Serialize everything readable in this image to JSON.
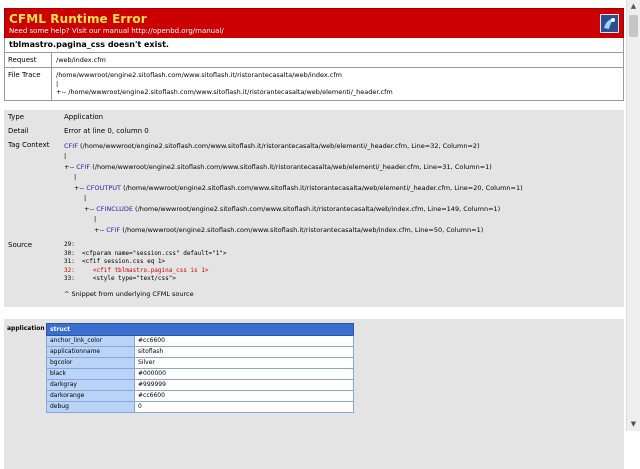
{
  "header": {
    "title": "CFML Runtime Error",
    "help_text": "Need some help? Visit our manual http://openbd.org/manual/",
    "logo_icon": "openbd-logo-icon"
  },
  "error": {
    "message": "tblmastro.pagina_css doesn't exist.",
    "request_label": "Request",
    "request_value": "/web/index.cfm",
    "filetrace_label": "File Trace",
    "filetrace_lines": [
      "/home/wwwroot/engine2.sitoflash.com/www.sitoflash.it/ristorantecasalta/web/index.cfm",
      "|",
      "+-- /home/wwwroot/engine2.sitoflash.com/www.sitoflash.it/ristorantecasalta/web/elementi/_header.cfm"
    ]
  },
  "details": {
    "type_label": "Type",
    "type_value": "Application",
    "detail_label": "Detail",
    "detail_value": "Error at line 0, column 0",
    "tag_context_label": "Tag Context",
    "tag_context": [
      {
        "prefix": "",
        "tag": "CFIF",
        "rest": " (/home/wwwroot/engine2.sitoflash.com/www.sitoflash.it/ristorantecasalta/web/elementi/_header.cfm, Line=32, Column=2)"
      },
      {
        "prefix": "|",
        "tag": "",
        "rest": ""
      },
      {
        "prefix": "+-- ",
        "tag": "CFIF",
        "rest": " (/home/wwwroot/engine2.sitoflash.com/www.sitoflash.it/ristorantecasalta/web/elementi/_header.cfm, Line=31, Column=1)"
      },
      {
        "prefix": "|",
        "tag": "",
        "rest": ""
      },
      {
        "prefix": "+-- ",
        "tag": "CFOUTPUT",
        "rest": " (/home/wwwroot/engine2.sitoflash.com/www.sitoflash.it/ristorantecasalta/web/elementi/_header.cfm, Line=20, Column=1)"
      },
      {
        "prefix": "|",
        "tag": "",
        "rest": ""
      },
      {
        "prefix": "+-- ",
        "tag": "CFINCLUDE",
        "rest": " (/home/wwwroot/engine2.sitoflash.com/www.sitoflash.it/ristorantecasalta/web/index.cfm, Line=149, Column=1)"
      },
      {
        "prefix": "|",
        "tag": "",
        "rest": ""
      },
      {
        "prefix": "+-- ",
        "tag": "CFIF",
        "rest": " (/home/wwwroot/engine2.sitoflash.com/www.sitoflash.it/ristorantecasalta/web/index.cfm, Line=50, Column=1)"
      }
    ],
    "source_label": "Source",
    "source_lines": [
      {
        "text": "29:",
        "highlight": false
      },
      {
        "text": "30:  <cfparam name=\"session.css\" default=\"1\">",
        "highlight": false
      },
      {
        "text": "31:  <cfif session.css eq 1>",
        "highlight": false
      },
      {
        "text": "32:     <cfif tblmastro.pagina_css is 1>",
        "highlight": true
      },
      {
        "text": "33:     <style type=\"text/css\">",
        "highlight": false
      }
    ],
    "source_note": "^ Snippet from underlying CFML source"
  },
  "application_scope": {
    "label": "application",
    "struct_header": "struct",
    "rows": [
      {
        "key": "anchor_link_color",
        "value": "#cc6600"
      },
      {
        "key": "applicationname",
        "value": "sitoflash"
      },
      {
        "key": "bgcolor",
        "value": "Silver"
      },
      {
        "key": "black",
        "value": "#000000"
      },
      {
        "key": "darkgray",
        "value": "#999999"
      },
      {
        "key": "darkorange",
        "value": "#cc6600"
      },
      {
        "key": "debug",
        "value": "0"
      }
    ]
  },
  "colors": {
    "header_bg": "#cc0000",
    "title": "#ffe14a",
    "tag_blue": "#2222aa",
    "struct_header": "#3a6fd0",
    "struct_key_bg": "#b9d4f6"
  }
}
